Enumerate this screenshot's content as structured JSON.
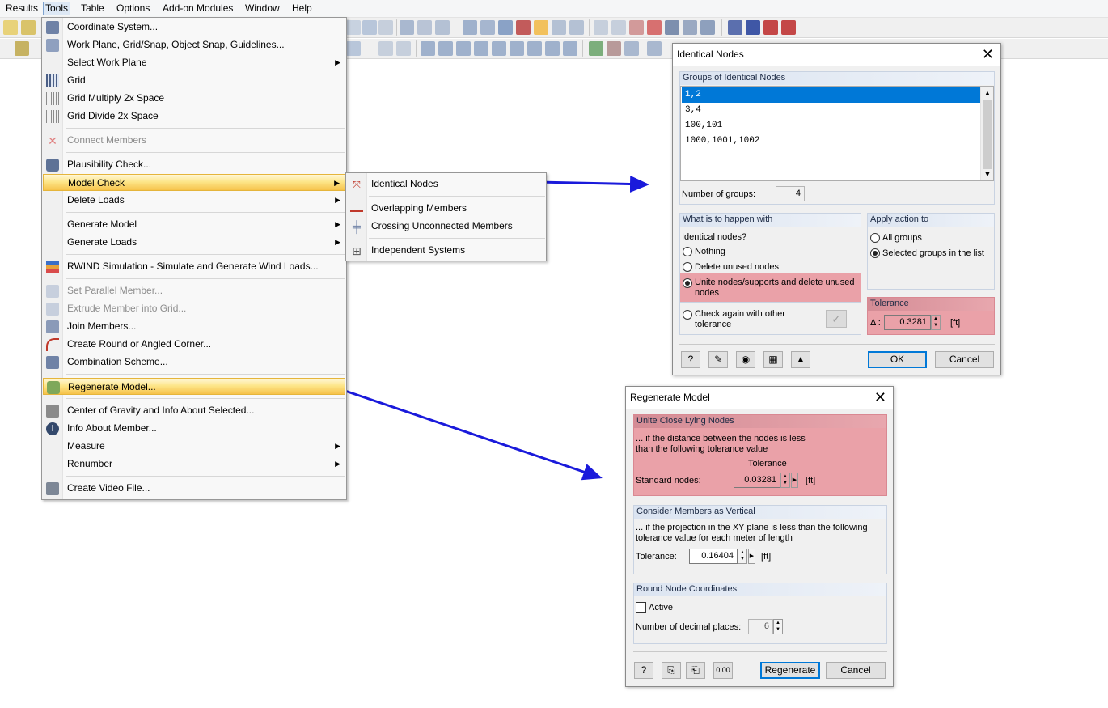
{
  "menubar": {
    "items": [
      "Results",
      "Tools",
      "Table",
      "Options",
      "Add-on Modules",
      "Window",
      "Help"
    ],
    "active": "Tools"
  },
  "tools_menu": {
    "items": [
      {
        "label": "Coordinate System...",
        "icon": "coordinate-system-icon"
      },
      {
        "label": "Work Plane, Grid/Snap, Object Snap, Guidelines...",
        "icon": "work-plane-icon"
      },
      {
        "label": "Select Work Plane",
        "icon": "none",
        "submenu": true
      },
      {
        "label": "Grid",
        "icon": "grid-icon"
      },
      {
        "label": "Grid Multiply 2x Space",
        "icon": "grid-multiply-icon"
      },
      {
        "label": "Grid Divide 2x Space",
        "icon": "grid-divide-icon"
      },
      {
        "label": "Connect Members",
        "icon": "connect-members-icon",
        "disabled": true
      },
      {
        "label": "Plausibility Check...",
        "icon": "plausibility-check-icon"
      },
      {
        "label": "Model Check",
        "icon": "none",
        "submenu": true,
        "highlighted": true
      },
      {
        "label": "Delete Loads",
        "icon": "none",
        "submenu": true
      },
      {
        "label": "Generate Model",
        "icon": "none",
        "submenu": true
      },
      {
        "label": "Generate Loads",
        "icon": "none",
        "submenu": true
      },
      {
        "label": "RWIND Simulation - Simulate and Generate Wind Loads...",
        "icon": "rwind-icon"
      },
      {
        "label": "Set Parallel Member...",
        "icon": "parallel-member-icon",
        "disabled": true
      },
      {
        "label": "Extrude Member into Grid...",
        "icon": "extrude-member-icon",
        "disabled": true
      },
      {
        "label": "Join Members...",
        "icon": "join-members-icon"
      },
      {
        "label": "Create Round or Angled Corner...",
        "icon": "round-corner-icon"
      },
      {
        "label": "Combination Scheme...",
        "icon": "combination-scheme-icon"
      },
      {
        "label": "Regenerate Model...",
        "icon": "regenerate-model-icon",
        "highlighted": true
      },
      {
        "label": "Center of Gravity and Info About Selected...",
        "icon": "center-of-gravity-icon"
      },
      {
        "label": "Info About Member...",
        "icon": "info-icon"
      },
      {
        "label": "Measure",
        "icon": "none",
        "submenu": true
      },
      {
        "label": "Renumber",
        "icon": "none",
        "submenu": true
      },
      {
        "label": "Create Video File...",
        "icon": "video-file-icon"
      }
    ]
  },
  "model_check_submenu": {
    "items": [
      {
        "label": "Identical Nodes",
        "icon": "identical-nodes-icon"
      },
      {
        "label": "Overlapping Members",
        "icon": "overlapping-members-icon"
      },
      {
        "label": "Crossing Unconnected Members",
        "icon": "crossing-members-icon"
      },
      {
        "label": "Independent Systems",
        "icon": "independent-systems-icon"
      }
    ]
  },
  "identical_nodes_dialog": {
    "title": "Identical Nodes",
    "groups_header": "Groups of Identical Nodes",
    "groups": [
      "1,2",
      "3,4",
      "100,101",
      "1000,1001,1002"
    ],
    "selected_group": "1,2",
    "number_of_groups_label": "Number of groups:",
    "number_of_groups": "4",
    "what_header": "What is to happen with",
    "identical_nodes_label": "Identical nodes?",
    "options": [
      {
        "label": "Nothing",
        "selected": false
      },
      {
        "label": "Delete unused nodes",
        "selected": false
      },
      {
        "label": "Unite nodes/supports and delete unused nodes",
        "selected": true
      },
      {
        "label": "Check again with other tolerance",
        "selected": false
      }
    ],
    "apply_header": "Apply action to",
    "apply_options": [
      {
        "label": "All groups",
        "selected": false
      },
      {
        "label": "Selected groups in the list",
        "selected": true
      }
    ],
    "tolerance_header": "Tolerance",
    "delta_label": "Δ :",
    "tolerance_value": "0.3281",
    "unit": "[ft]",
    "ok_label": "OK",
    "cancel_label": "Cancel",
    "highlight_color": "#eaa1a8"
  },
  "regenerate_dialog": {
    "title": "Regenerate Model",
    "unite_header": "Unite Close Lying Nodes",
    "unite_desc_1": "... if the distance between the nodes is less",
    "unite_desc_2": "than the following tolerance value",
    "tolerance_caption": "Tolerance",
    "standard_nodes_label": "Standard nodes:",
    "standard_nodes_value": "0.03281",
    "unit": "[ft]",
    "vertical_header": "Consider Members as Vertical",
    "vertical_desc_1": "... if the projection in the XY plane is less than the following",
    "vertical_desc_2": "tolerance value for each meter of length",
    "tolerance_label": "Tolerance:",
    "vertical_tolerance_value": "0.16404",
    "round_header": "Round Node Coordinates",
    "active_label": "Active",
    "active_checked": false,
    "decimal_places_label": "Number of decimal places:",
    "decimal_places_value": "6",
    "regenerate_label": "Regenerate",
    "cancel_label": "Cancel"
  },
  "annotation_arrow_color": "#1a1adb"
}
